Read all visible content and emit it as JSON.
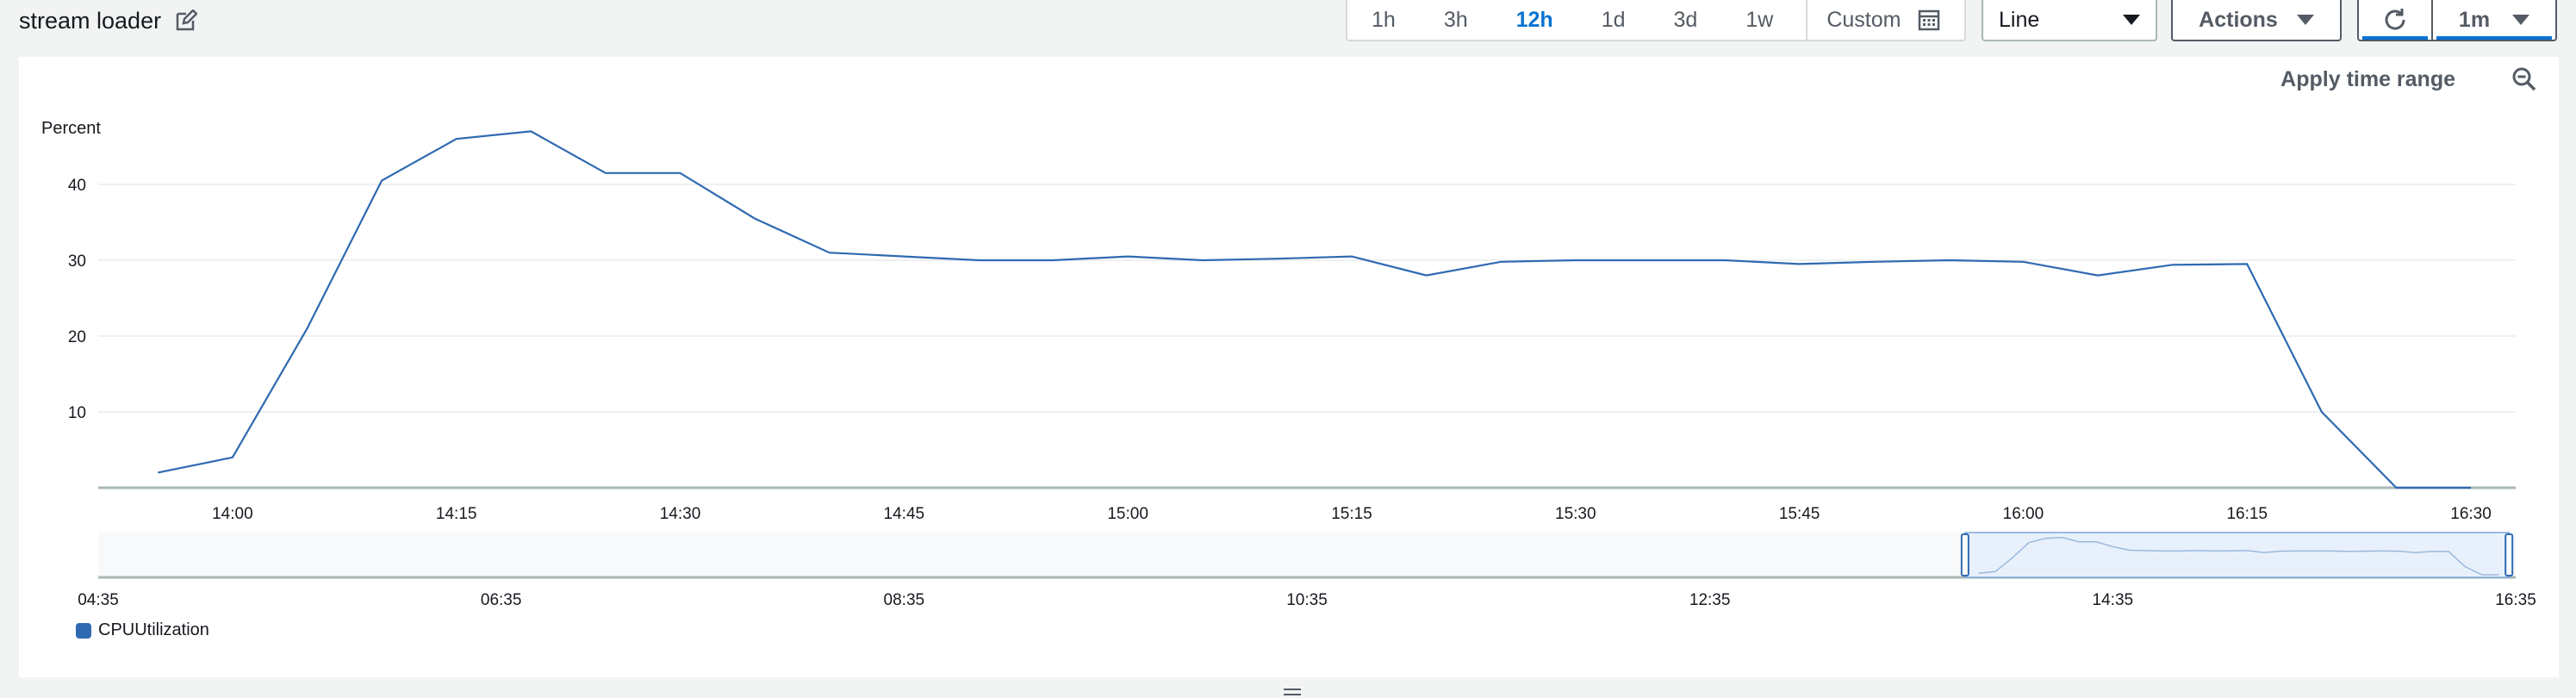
{
  "header": {
    "title": "stream loader",
    "time_ranges": [
      "1h",
      "3h",
      "12h",
      "1d",
      "3d",
      "1w"
    ],
    "active_range": "12h",
    "custom_label": "Custom",
    "chart_type_value": "Line",
    "actions_label": "Actions",
    "refresh_interval": "1m"
  },
  "panel": {
    "apply_label": "Apply time range",
    "y_unit_label": "Percent",
    "legend_label": "CPUUtilization",
    "series_color": "#2f6ab1"
  },
  "chart_data": {
    "type": "line",
    "ylabel": "Percent",
    "ylim": [
      0,
      50
    ],
    "yticks": [
      10,
      20,
      30,
      40
    ],
    "xticks": [
      "14:00",
      "14:15",
      "14:30",
      "14:45",
      "15:00",
      "15:15",
      "15:30",
      "15:45",
      "16:00",
      "16:15",
      "16:30"
    ],
    "xrange": [
      "13:51",
      "16:33"
    ],
    "series": [
      {
        "name": "CPUUtilization",
        "x": [
          "13:55",
          "14:00",
          "14:05",
          "14:10",
          "14:15",
          "14:20",
          "14:25",
          "14:30",
          "14:35",
          "14:40",
          "14:45",
          "14:50",
          "14:55",
          "15:00",
          "15:05",
          "15:10",
          "15:15",
          "15:20",
          "15:25",
          "15:30",
          "15:35",
          "15:40",
          "15:45",
          "15:50",
          "15:55",
          "16:00",
          "16:05",
          "16:10",
          "16:15",
          "16:20",
          "16:25",
          "16:30"
        ],
        "values": [
          2,
          4,
          21,
          40.5,
          46,
          47,
          41.5,
          41.5,
          35.5,
          31,
          30.5,
          30,
          30,
          30.5,
          30,
          30.2,
          30.5,
          28,
          29.8,
          30,
          30,
          30,
          29.5,
          29.8,
          30,
          29.8,
          28,
          29.4,
          29.5,
          10,
          0,
          0
        ]
      }
    ],
    "overview": {
      "xticks": [
        "04:35",
        "06:35",
        "08:35",
        "10:35",
        "12:35",
        "14:35",
        "16:35"
      ],
      "selection": [
        "13:51",
        "16:33"
      ]
    }
  }
}
